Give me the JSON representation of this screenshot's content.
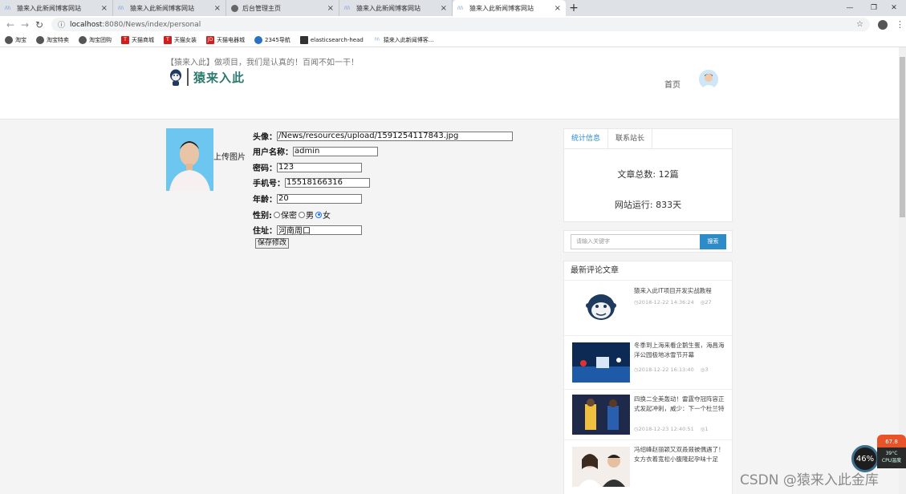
{
  "browser": {
    "tabs": [
      {
        "label": "猿来入此新闻博客网站",
        "icon": "site-icon"
      },
      {
        "label": "猿来入此新闻博客网站",
        "icon": "site-icon"
      },
      {
        "label": "后台管理主页",
        "icon": "globe-icon"
      },
      {
        "label": "猿来入此新闻博客网站",
        "icon": "site-icon"
      },
      {
        "label": "猿来入此新闻博客网站",
        "icon": "site-icon",
        "active": true
      }
    ],
    "url_host": "localhost",
    "url_rest": ":8080/News/index/personal",
    "bookmarks": [
      {
        "label": "淘宝",
        "color": "#555555"
      },
      {
        "label": "淘宝特卖",
        "color": "#555555"
      },
      {
        "label": "淘宝团购",
        "color": "#555555"
      },
      {
        "label": "天猫商城",
        "color": "#d01d1d"
      },
      {
        "label": "天猫女装",
        "color": "#d01d1d"
      },
      {
        "label": "天猫电器城",
        "color": "#d01d1d"
      },
      {
        "label": "2345导航",
        "color": "#2a6fc9"
      },
      {
        "label": "elasticsearch-head",
        "color": "#333333"
      },
      {
        "label": "猿来入此新闻博客...",
        "color": "#6b8fd6"
      }
    ]
  },
  "header": {
    "slogan": "【猿来入此】做项目，我们是认真的！百闻不如一干！",
    "logo_text": "猿来入此",
    "nav_home": "首页"
  },
  "profile": {
    "upload_label": "上传图片",
    "avatar_label": "头像：",
    "avatar_path": "/News/resources/upload/1591254117843.jpg",
    "username_label": "用户名称：",
    "username": "admin",
    "password_label": "密码：",
    "password": "123",
    "phone_label": "手机号：",
    "phone": "15518166316",
    "age_label": "年龄：",
    "age": "20",
    "gender_label": "性别:",
    "gender_options": [
      "保密",
      "男",
      "女"
    ],
    "gender_selected": "女",
    "address_label": "住址：",
    "address": "河南周口",
    "save_label": "保存修改"
  },
  "sidebar": {
    "tabs": [
      "统计信息",
      "联系站长"
    ],
    "article_total": "文章总数: 12篇",
    "site_uptime": "网站运行: 833天",
    "search_placeholder": "请输入关键字",
    "search_button": "搜索",
    "recent_title": "最新评论文章",
    "articles": [
      {
        "title": "猿来入此IT项目开发实战教程",
        "date": "◷2018-12-22 14:36:24",
        "views": "◎27"
      },
      {
        "title": "冬季到上海来看企鹅生蛋，海昌海洋公园极地冰雪节开幕",
        "date": "◷2018-12-22 16:13:40",
        "views": "◎3"
      },
      {
        "title": "四换二全美轰动！雷霆夺冠阵容正式发起冲刺，威少：下一个杜兰特",
        "date": "◷2018-12-23 12:40:51",
        "views": "◎1"
      },
      {
        "title": "冯绍峰赵丽颖又双叒叕被偶遇了！女方衣着宽松小腹隆起孕味十足",
        "date": "",
        "views": ""
      }
    ]
  },
  "overlay": {
    "cpu_percent": "46%",
    "cpu_temp_top": "67.8",
    "cpu_temp": "39°C",
    "cpu_label": "CPU温度",
    "watermark": "CSDN @猿来入此金库"
  }
}
